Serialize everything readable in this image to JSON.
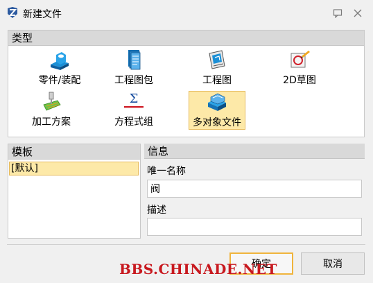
{
  "window": {
    "title": "新建文件",
    "icon": "zw3d-logo-icon"
  },
  "type_section": {
    "header": "类型",
    "items": [
      {
        "label": "零件/装配",
        "icon": "part-assembly-icon",
        "selected": false
      },
      {
        "label": "工程图包",
        "icon": "drawing-pack-icon",
        "selected": false
      },
      {
        "label": "工程图",
        "icon": "drawing-icon",
        "selected": false
      },
      {
        "label": "2D草图",
        "icon": "sketch-2d-icon",
        "selected": false
      },
      {
        "label": "加工方案",
        "icon": "cam-plan-icon",
        "selected": false
      },
      {
        "label": "方程式组",
        "icon": "equation-set-icon",
        "selected": false
      },
      {
        "label": "多对象文件",
        "icon": "multi-object-file-icon",
        "selected": true
      }
    ]
  },
  "template_section": {
    "header": "模板",
    "items": [
      {
        "label": "[默认]",
        "selected": true
      }
    ]
  },
  "info_section": {
    "header": "信息",
    "name_label": "唯一名称",
    "name_value": "阀",
    "desc_label": "描述",
    "desc_value": ""
  },
  "buttons": {
    "ok": "确定",
    "cancel": "取消"
  },
  "watermark": "BBS.CHINADE.NET",
  "colors": {
    "selection_fill": "#fde9a8",
    "selection_border": "#e6b95a",
    "header_bg": "#d9d9d9",
    "watermark": "#c8191f"
  }
}
